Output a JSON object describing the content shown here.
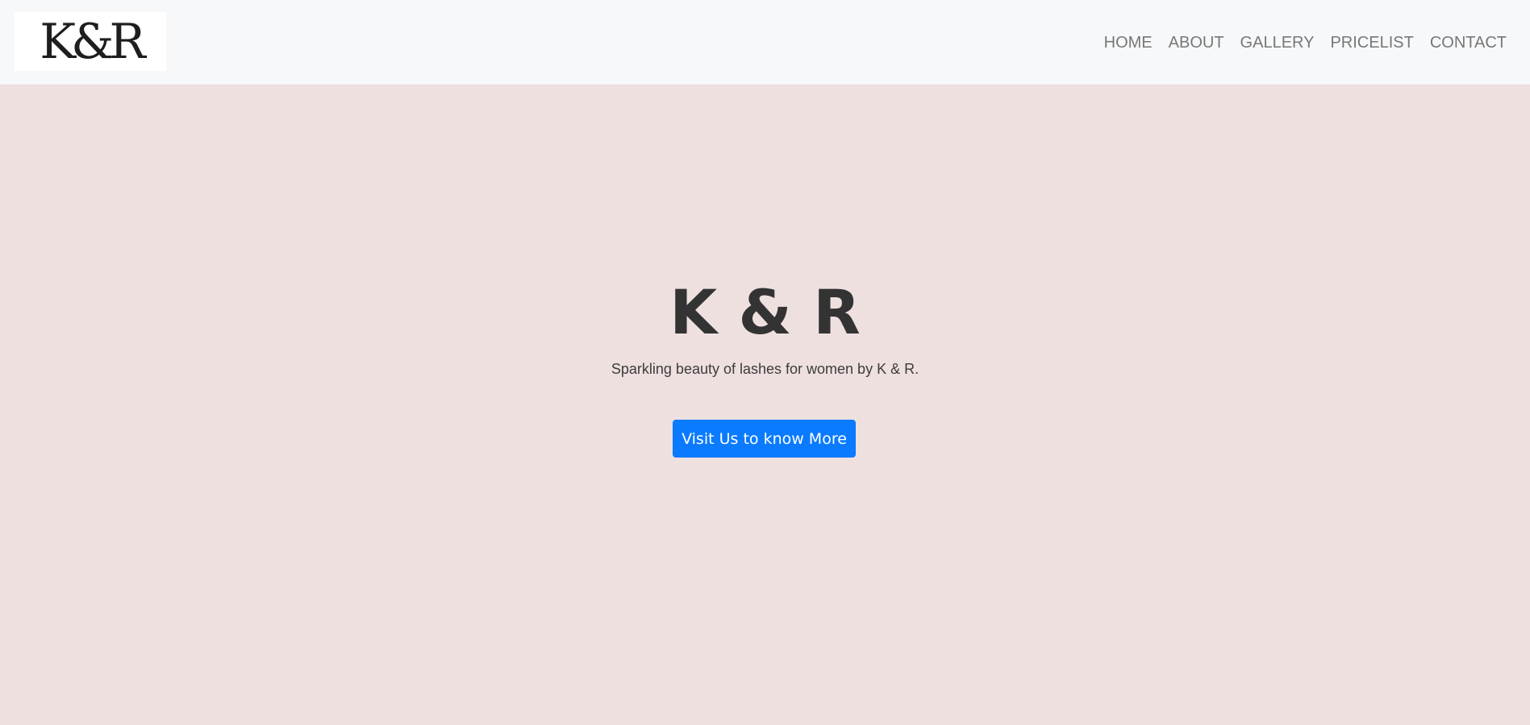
{
  "navbar": {
    "logo_text": "K&R",
    "links": [
      "HOME",
      "ABOUT",
      "GALLERY",
      "PRICELIST",
      "CONTACT"
    ]
  },
  "hero": {
    "title": "K & R",
    "subtitle": "Sparkling beauty of lashes for women by K & R.",
    "button_label": "Visit Us to know More"
  },
  "colors": {
    "navbar_bg": "#f7f8fa",
    "hero_bg": "#efe0e0",
    "button_bg": "#0a7bff",
    "nav_text": "#777777",
    "title_text": "#333333"
  }
}
